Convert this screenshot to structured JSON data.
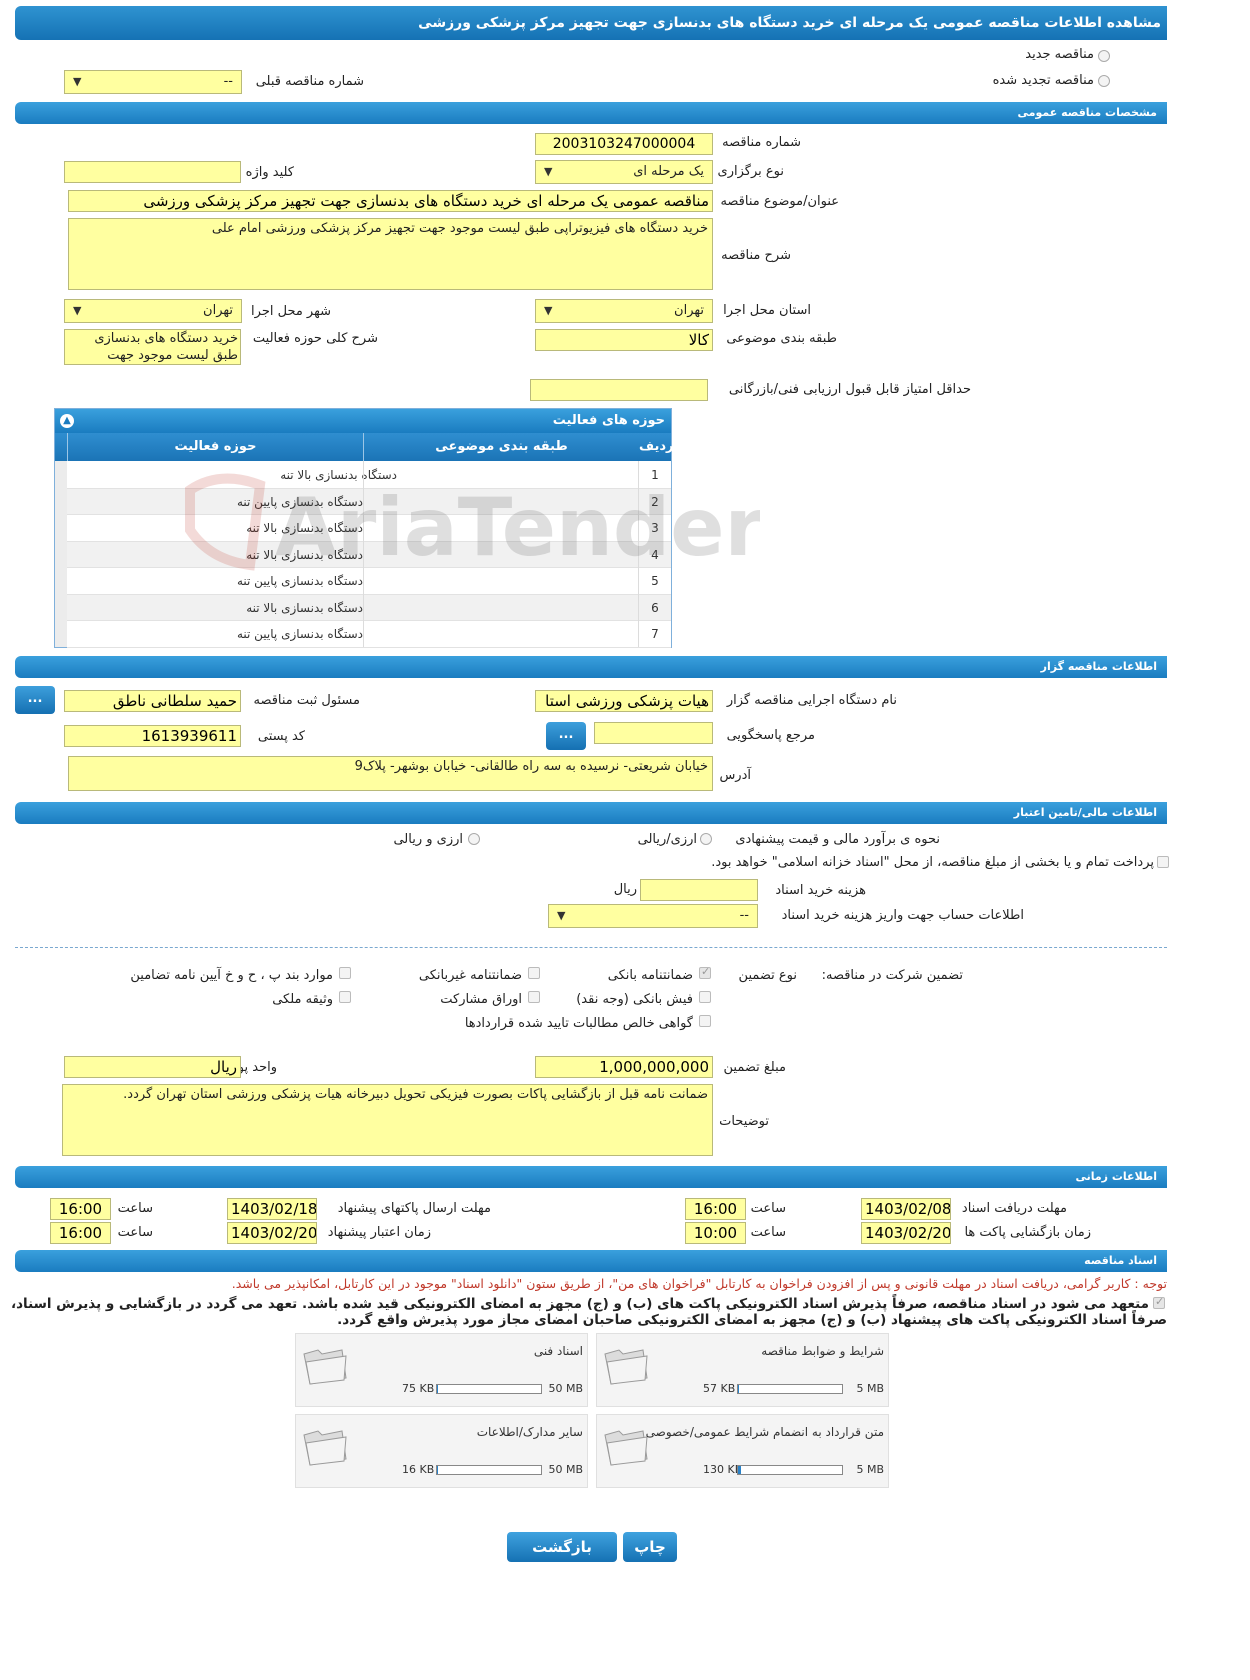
{
  "page_title": "مشاهده اطلاعات مناقصه عمومی یک مرحله ای خرید دستگاه های بدنسازی جهت تجهیز مرکز پزشکی ورزشی",
  "top": {
    "new_tender": "مناقصه جدید",
    "renewed_tender": "مناقصه تجدید شده",
    "prev_tender_label": "شماره مناقصه قبلی",
    "prev_tender_value": "--"
  },
  "general": {
    "section_title": "مشخصات مناقصه عمومی",
    "tender_no_label": "شماره مناقصه",
    "tender_no": "2003103247000004",
    "holding_type_label": "نوع برگزاری",
    "holding_type": "یک مرحله ای",
    "keyword_label": "کلید واژه",
    "keyword": "",
    "subject_label": "عنوان/موضوع مناقصه",
    "subject": "مناقصه عمومی یک مرحله ای خرید دستگاه های بدنسازی جهت تجهیز مرکز پزشکی ورزشی",
    "desc_label": "شرح مناقصه",
    "desc": "خرید دستگاه های فیزیوتراپی طبق لیست موجود جهت تجهیز مرکز پزشکی ورزشی امام علی",
    "province_label": "استان محل اجرا",
    "province": "تهران",
    "city_label": "شهر محل اجرا",
    "city": "تهران",
    "category_label": "طبقه بندی موضوعی",
    "category": "کالا",
    "activity_desc_label": "شرح کلی حوزه فعالیت",
    "activity_desc": "خرید دستگاه های بدنسازی طبق لیست موجود جهت",
    "min_score_label": "حداقل امتیاز قابل قبول ارزیابی فنی/بازرگانی",
    "min_score": ""
  },
  "activities": {
    "title": "حوزه های فعالیت",
    "col_row": "ردیف",
    "col_category": "طبقه بندی موضوعی",
    "col_field": "حوزه فعالیت",
    "rows": [
      {
        "n": "1",
        "field": "دستگاه بدنسازی بالا تنه"
      },
      {
        "n": "2",
        "field": "دستگاه بدنسازی پایین تنه"
      },
      {
        "n": "3",
        "field": "دستگاه بدنسازی بالا تنه"
      },
      {
        "n": "4",
        "field": "دستگاه بدنسازی بالا تنه"
      },
      {
        "n": "5",
        "field": "دستگاه بدنسازی پایین تنه"
      },
      {
        "n": "6",
        "field": "دستگاه بدنسازی بالا تنه"
      },
      {
        "n": "7",
        "field": "دستگاه بدنسازی پایین تنه"
      }
    ]
  },
  "organizer": {
    "section_title": "اطلاعات مناقصه گزار",
    "org_label": "نام دستگاه اجرایی مناقصه گزار",
    "org": "هیات پزشکی ورزشی استا",
    "resp_label": "مسئول ثبت مناقصه",
    "resp": "حمید سلطانی ناطق",
    "ref_label": "مرجع پاسخگویی",
    "ref": "",
    "postal_label": "کد پستی",
    "postal": "1613939611",
    "address_label": "آدرس",
    "address": "خیابان شریعتی- نرسیده به سه راه طالقانی- خیابان بوشهر- پلاک9",
    "dots": "..."
  },
  "finance": {
    "section_title": "اطلاعات مالی/تامین اعتبار",
    "estimate_label": "نحوه ی برآورد مالی و قیمت پیشنهادی",
    "opt_rial": "ارزی/ریالی",
    "opt_fx": "ارزی و ریالی",
    "treasury_text": "پرداخت تمام و یا بخشی از مبلغ مناقصه، از محل \"اسناد خزانه اسلامی\" خواهد بود.",
    "doc_cost_label": "هزینه خرید اسناد",
    "doc_cost_unit": "ریال",
    "account_label": "اطلاعات حساب جهت واریز هزینه خرید اسناد",
    "account_value": "--",
    "guarantee_label": "تضمین شرکت در مناقصه:",
    "guarantee_type_label": "نوع تضمین",
    "g_bank": "ضمانتنامه بانکی",
    "g_nonbank": "ضمانتنامه غیربانکی",
    "g_clauses": "موارد بند پ ، ح و خ آیین نامه تضامین",
    "g_cash": "فیش بانکی (وجه نقد)",
    "g_bonds": "اوراق مشارکت",
    "g_property": "وثیقه ملکی",
    "g_claims": "گواهی خالص مطالبات تایید شده قراردادها",
    "amount_label": "مبلغ تضمین",
    "amount": "1,000,000,000",
    "currency_label": "واحد پول",
    "currency": "ریال",
    "notes_label": "توضیحات",
    "notes": "ضمانت نامه قبل از بازگشایی پاکات بصورت فیزیکی تحویل دبیرخانه هیات پزشکی ورزشی استان تهران گردد."
  },
  "timing": {
    "section_title": "اطلاعات زمانی",
    "doc_deadline_label": "مهلت دریافت اسناد",
    "doc_deadline": "1403/02/08",
    "doc_deadline_time": "16:00",
    "send_deadline_label": "مهلت ارسال پاکتهای پیشنهاد",
    "send_deadline": "1403/02/18",
    "send_deadline_time": "16:00",
    "opening_label": "زمان بازگشایی پاکت ها",
    "opening": "1403/02/20",
    "opening_time": "10:00",
    "validity_label": "زمان اعتبار پیشنهاد",
    "validity": "1403/02/20",
    "validity_time": "16:00",
    "time_label": "ساعت"
  },
  "documents": {
    "section_title": "اسناد مناقصه",
    "notice": "توجه : کاربر گرامی، دریافت اسناد در مهلت قانونی و پس از افزودن فراخوان به کارتابل \"فراخوان های من\"، از طریق ستون \"دانلود اسناد\" موجود در این کارتابل، امکانپذیر می باشد.",
    "commit_line1": "متعهد می شود در اسناد مناقصه، صرفاً پذیرش اسناد الکترونیکی پاکت های (ب) و (ج) مجهز به امضای الکترونیکی قید شده باشد. تعهد می گردد در بازگشایی و پذیرش اسناد،",
    "commit_line2": "صرفاً اسناد الکترونیکی پاکت های پیشنهاد (ب) و (ج) مجهز به امضای الکترونیکی صاحبان امضای مجاز مورد پذیرش واقع گردد.",
    "files": [
      {
        "name": "شرایط و ضوابط مناقصه",
        "size": "57 KB",
        "max": "5 MB",
        "ratio": 0.011
      },
      {
        "name": "اسناد فنی",
        "size": "75 KB",
        "max": "50 MB",
        "ratio": 0.0015
      },
      {
        "name": "متن قرارداد به انضمام شرایط عمومی/خصوصی",
        "size": "130 KB",
        "max": "5 MB",
        "ratio": 0.025
      },
      {
        "name": "سایر مدارک/اطلاعات",
        "size": "16 KB",
        "max": "50 MB",
        "ratio": 0.0003
      }
    ]
  },
  "buttons": {
    "back": "بازگشت",
    "print": "چاپ"
  },
  "watermark": "AriaTender.neT",
  "colors": {
    "bar": "#1a7cc0",
    "field": "#ffffa0",
    "notice": "#c0392b"
  }
}
